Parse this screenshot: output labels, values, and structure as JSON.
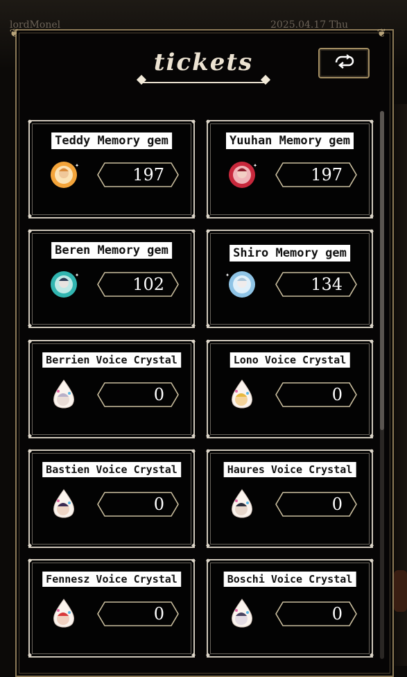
{
  "background": {
    "top_left_text": "lordMonel",
    "top_right_text": "2025.04.17 Thu"
  },
  "header": {
    "title": "tickets",
    "refresh_icon": "refresh-icon"
  },
  "tickets": [
    {
      "label": "Teddy Memory gem",
      "value": "197",
      "icon": "gem-icon"
    },
    {
      "label": "Yuuhan Memory gem",
      "value": "197",
      "icon": "gem-icon"
    },
    {
      "label": "Beren Memory gem",
      "value": "102",
      "icon": "gem-icon"
    },
    {
      "label": "Shiro Memory gem",
      "value": "134",
      "icon": "gem-icon"
    },
    {
      "label": "Berrien Voice Crystal",
      "value": "0",
      "icon": "crystal-icon"
    },
    {
      "label": "Lono Voice Crystal",
      "value": "0",
      "icon": "crystal-icon"
    },
    {
      "label": "Bastien Voice Crystal",
      "value": "0",
      "icon": "crystal-icon"
    },
    {
      "label": "Haures Voice Crystal",
      "value": "0",
      "icon": "crystal-icon"
    },
    {
      "label": "Fennesz Voice Crystal",
      "value": "0",
      "icon": "crystal-icon"
    },
    {
      "label": "Boschi Voice Crystal",
      "value": "0",
      "icon": "crystal-icon"
    }
  ]
}
